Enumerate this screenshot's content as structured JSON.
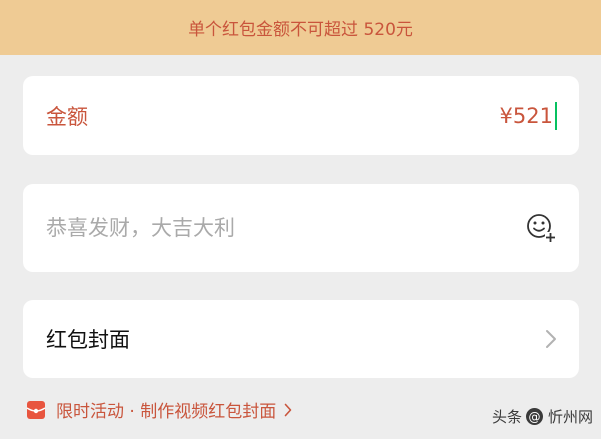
{
  "banner": {
    "warning_text": "单个红包金额不可超过 520元"
  },
  "amount": {
    "label": "金额",
    "value": "¥521"
  },
  "greeting": {
    "placeholder": "恭喜发财，大吉大利",
    "emoji_icon": "emoji-plus-icon"
  },
  "cover": {
    "label": "红包封面",
    "chevron_icon": "chevron-right-icon"
  },
  "promo": {
    "text": "限时活动 · 制作视频红包封面",
    "icon": "red-packet-icon"
  },
  "watermark": {
    "prefix": "头条",
    "at_symbol": "@",
    "account": "忻州网"
  },
  "colors": {
    "accent": "#C9553C",
    "banner_bg": "#EFCB94",
    "caret": "#07C160",
    "page_bg": "#EDEDED"
  }
}
